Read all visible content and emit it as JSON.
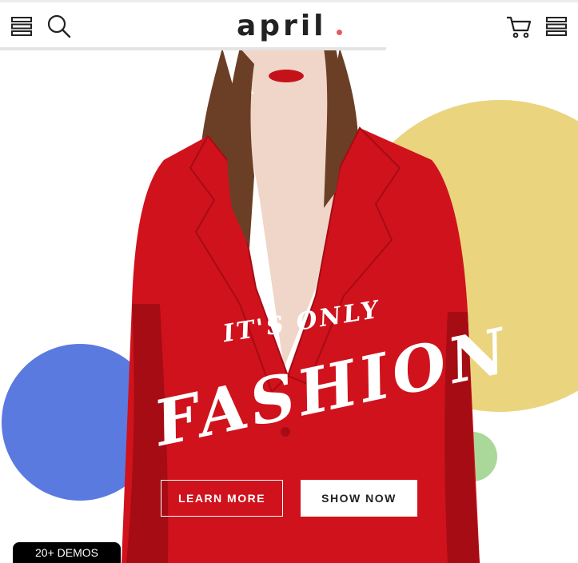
{
  "header": {
    "logo_text": "april",
    "logo_dot_color": "#e8595a",
    "menu_icon": "menu-icon",
    "search_icon": "search-icon",
    "cart_icon": "cart-icon",
    "account_menu_icon": "menu-icon"
  },
  "hero": {
    "tagline_small": "IT'S ONLY",
    "tagline_big": "FASHION",
    "learn_more_label": "LEARN MORE",
    "show_now_label": "SHOW NOW",
    "colors": {
      "coat": "#d0121c",
      "coat_dark": "#a50c14",
      "skin": "#f0d6c8",
      "hair": "#6b3f26",
      "yellow_circle": "#ead47e",
      "blue_circle": "#5a7ae0",
      "green_circle": "#a9d89a",
      "lips": "#c4121b"
    }
  },
  "demos_badge": {
    "label": "20+ DEMOS"
  }
}
